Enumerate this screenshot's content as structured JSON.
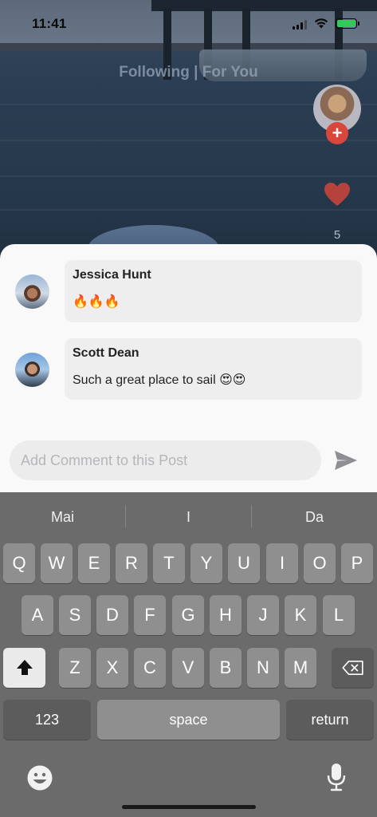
{
  "status_bar": {
    "time": "11:41"
  },
  "feed": {
    "tabs_label": "Following | For You",
    "like_count": "5"
  },
  "comments": [
    {
      "author": "Jessica Hunt",
      "text": "🔥🔥🔥"
    },
    {
      "author": "Scott Dean",
      "text": "Such a great place to sail 😍😍"
    }
  ],
  "comment_input": {
    "placeholder": "Add Comment to this Post",
    "value": ""
  },
  "keyboard": {
    "suggestions": [
      "Mai",
      "I",
      "Da"
    ],
    "row1": [
      "Q",
      "W",
      "E",
      "R",
      "T",
      "Y",
      "U",
      "I",
      "O",
      "P"
    ],
    "row2": [
      "A",
      "S",
      "D",
      "F",
      "G",
      "H",
      "J",
      "K",
      "L"
    ],
    "row3": [
      "Z",
      "X",
      "C",
      "V",
      "B",
      "N",
      "M"
    ],
    "numbers_label": "123",
    "space_label": "space",
    "return_label": "return"
  },
  "colors": {
    "accent_red": "#d9463c",
    "battery_green": "#34c759",
    "sheet_bg": "#f9f9f9",
    "bubble_bg": "#eeeeef",
    "keyboard_bg": "#6b6b6b"
  }
}
